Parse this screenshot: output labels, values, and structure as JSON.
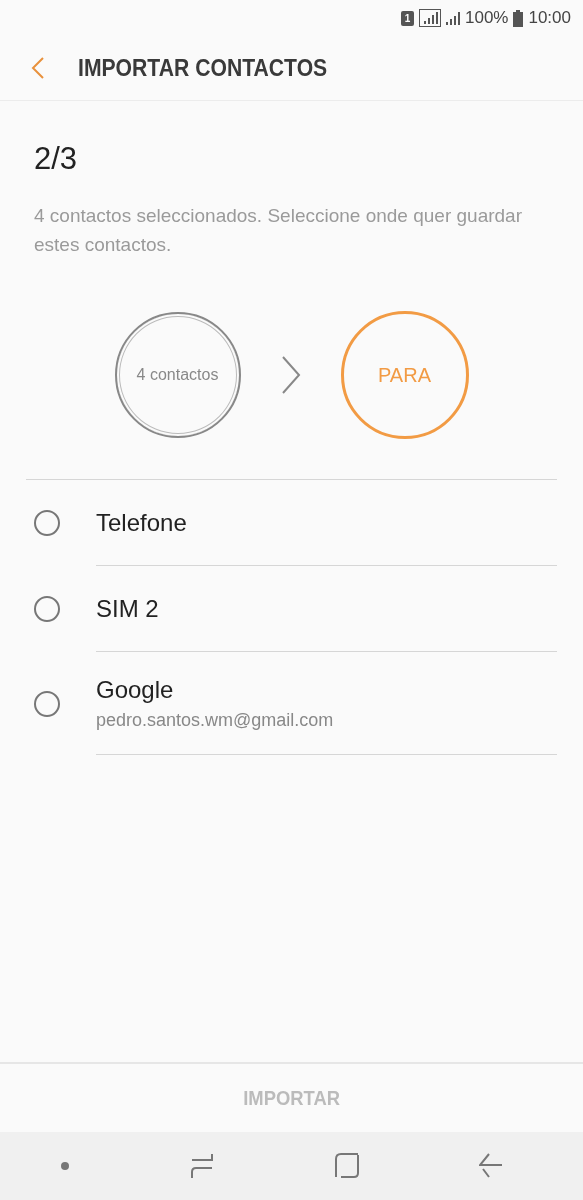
{
  "status_bar": {
    "sim": "1",
    "battery": "100%",
    "time": "10:00"
  },
  "header": {
    "title": "IMPORTAR CONTACTOS"
  },
  "step": {
    "counter": "2/3",
    "description": "4 contactos seleccionados. Seleccione onde quer guardar estes contactos.",
    "from": "4 contactos",
    "to": "PARA"
  },
  "options": [
    {
      "label": "Telefone",
      "selected": false
    },
    {
      "label": "SIM 2",
      "selected": false
    },
    {
      "label": "Google",
      "account": "pedro.santos.wm@gmail.com",
      "selected": false
    }
  ],
  "import_button": {
    "label": "IMPORTAR",
    "disabled": true
  }
}
